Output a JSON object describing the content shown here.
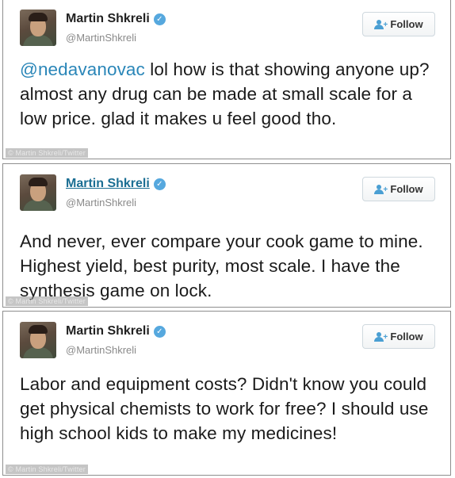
{
  "tweets": [
    {
      "name": "Martin Shkreli",
      "handle": "@MartinShkreli",
      "follow_label": "Follow",
      "mention": "@nedavanovac",
      "text": " lol how is that showing anyone up? almost any drug can be made at small scale for a low price. glad it makes u feel good tho.",
      "watermark": "© Martin Shkreli/Twitter"
    },
    {
      "name": "Martin Shkreli",
      "handle": "@MartinShkreli",
      "follow_label": "Follow",
      "text": "And never, ever compare your cook game to mine. Highest yield, best purity, most scale. I have the synthesis game on lock.",
      "watermark": "© Martin Shkreli/Twitter"
    },
    {
      "name": "Martin Shkreli",
      "handle": "@MartinShkreli",
      "follow_label": "Follow",
      "text": "Labor and equipment costs? Didn't know you could get physical chemists to work for free? I should use high school kids to make my medicines!",
      "watermark": "© Martin Shkreli/Twitter"
    }
  ],
  "icons": {
    "verified": "verified-badge-icon",
    "follow": "add-person-icon",
    "avatar": "profile-avatar"
  },
  "colors": {
    "link": "#2a86b8",
    "verified": "#56a8de",
    "handle": "#8a8a8a"
  }
}
